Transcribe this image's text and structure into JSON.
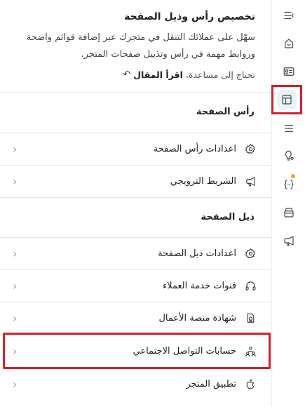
{
  "intro": {
    "title": "تخصيص رأس وذيل الصفحة",
    "description": "سهّل على عملائك التنقل في متجرك عبر إضافة قوائم واضحة وروابط مهمة في رأس وتذييل صفحات المتجر.",
    "help_prefix": "تحتاج إلى مساعدة،",
    "help_link": "اقرأ المقال"
  },
  "header_section": {
    "title": "رأس الصفحة",
    "items": [
      {
        "label": "اعدادات رأس الصفحة",
        "icon": "gear-icon"
      },
      {
        "label": "الشريط الترويجي",
        "icon": "megaphone-icon"
      }
    ]
  },
  "footer_section": {
    "title": "ذيل الصفحة",
    "items": [
      {
        "label": "اعدادات ذيل الصفحة",
        "icon": "gear-icon"
      },
      {
        "label": "قنوات خدمة العملاء",
        "icon": "headset-icon"
      },
      {
        "label": "شهادة منصة الأعمال",
        "icon": "certificate-icon"
      },
      {
        "label": "حسابات التواصل الاجتماعي",
        "icon": "social-accounts-icon"
      },
      {
        "label": "تطبيق المتجر",
        "icon": "apple-icon"
      }
    ]
  },
  "rail": {
    "items": [
      "collapse-menu-icon",
      "home-icon",
      "id-card-icon",
      "theme-layout-icon",
      "menu-lines-icon",
      "bulb-settings-icon",
      "code-braces-icon",
      "package-icon",
      "promotion-megaphone-icon"
    ]
  },
  "colors": {
    "accent_highlight": "#d61f2c",
    "active_bg": "#e9f3f1",
    "notification_dot": "#f5a623"
  }
}
